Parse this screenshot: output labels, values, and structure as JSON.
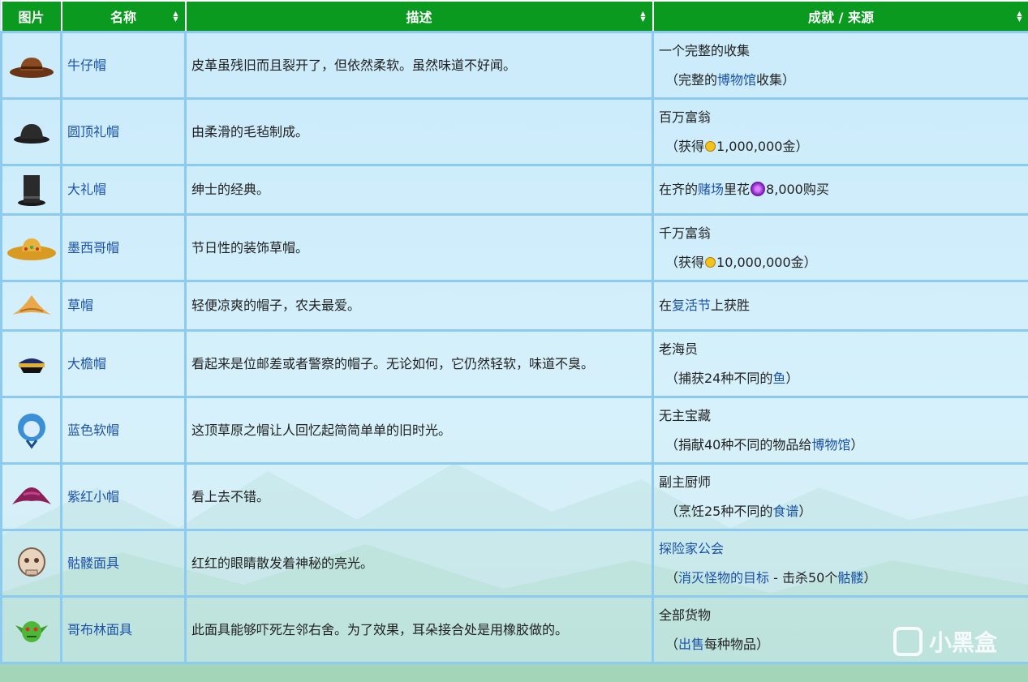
{
  "header": {
    "picture": "图片",
    "name": "名称",
    "description": "描述",
    "source": "成就 / 来源"
  },
  "rows": [
    {
      "icon": "cowboy-hat-icon",
      "name": "牛仔帽",
      "desc": "皮革虽残旧而且裂开了，但依然柔软。虽然味道不好闻。",
      "src_main": "一个完整的收集",
      "src_sub_pre": "（完整的",
      "src_sub_link": "博物馆",
      "src_sub_post": "收集）"
    },
    {
      "icon": "bowler-hat-icon",
      "name": "圆顶礼帽",
      "desc": "由柔滑的毛毡制成。",
      "src_main": "百万富翁",
      "src_sub_pre": "（获得",
      "src_sub_value": "1,000,000金）"
    },
    {
      "icon": "top-hat-icon",
      "name": "大礼帽",
      "desc": "绅士的经典。",
      "src_pre": "在齐的",
      "src_link": "赌场",
      "src_mid": "里花",
      "src_post": "8,000购买"
    },
    {
      "icon": "sombrero-icon",
      "name": "墨西哥帽",
      "desc": "节日性的装饰草帽。",
      "src_main": "千万富翁",
      "src_sub_pre": "（获得",
      "src_sub_value": "10,000,000金）"
    },
    {
      "icon": "straw-hat-icon",
      "name": "草帽",
      "desc": "轻便凉爽的帽子，农夫最爱。",
      "src_pre": "在",
      "src_link": "复活节",
      "src_post": "上获胜"
    },
    {
      "icon": "official-cap-icon",
      "name": "大檐帽",
      "desc": "看起来是位邮差或者警察的帽子。无论如何，它仍然轻软，味道不臭。",
      "src_main": "老海员",
      "src_sub_pre": "（捕获24种不同的",
      "src_sub_link": "鱼",
      "src_sub_post": "）"
    },
    {
      "icon": "blue-bonnet-icon",
      "name": "蓝色软帽",
      "desc": "这顶草原之帽让人回忆起简简单单的旧时光。",
      "src_main": "无主宝藏",
      "src_sub_pre": "（捐献40种不同的物品给",
      "src_sub_link": "博物馆",
      "src_sub_post": "）"
    },
    {
      "icon": "plum-chapeau-icon",
      "name": "紫红小帽",
      "desc": "看上去不错。",
      "src_main": "副主厨师",
      "src_sub_pre": "（烹饪25种不同的",
      "src_sub_link": "食谱",
      "src_sub_post": "）"
    },
    {
      "icon": "skeleton-mask-icon",
      "name": "骷髅面具",
      "desc": "红红的眼睛散发着神秘的亮光。",
      "src_main_link": "探险家公会",
      "src_sub_pre": "（",
      "src_sub_link": "消灭怪物的目标",
      "src_sub_mid": " - 击杀50个",
      "src_sub_link2": "骷髅",
      "src_sub_post": "）"
    },
    {
      "icon": "goblin-mask-icon",
      "name": "哥布林面具",
      "desc": "此面具能够吓死左邻右舍。为了效果，耳朵接合处是用橡胶做的。",
      "src_main": "全部货物",
      "src_sub_pre": "（",
      "src_sub_link": "出售",
      "src_sub_post": "每种物品）"
    }
  ],
  "watermark": "小黑盒",
  "colors": {
    "header_bg": "#0a9a1f",
    "link": "#1c52a8",
    "border": "#8ccaf0"
  }
}
